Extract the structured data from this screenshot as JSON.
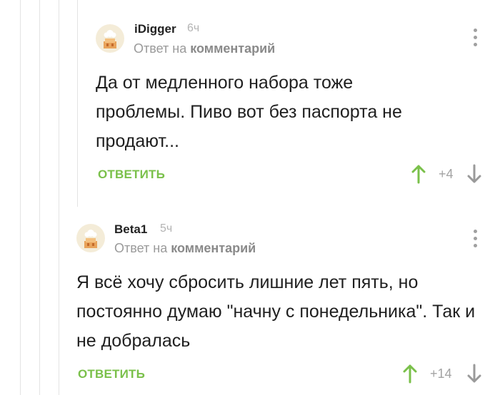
{
  "comments": [
    {
      "author": "iDigger",
      "time": "6ч",
      "reply_prefix": "Ответ на",
      "reply_link": "комментарий",
      "text": "Да от медленного набора тоже проблемы. Пиво вот без паспорта не продают...",
      "reply_button": "ОТВЕТИТЬ",
      "rating": "+4",
      "avatar_icon": "default-avatar-icon",
      "menu_icon": "more-vertical-icon"
    },
    {
      "author": "Beta1",
      "time": "5ч",
      "reply_prefix": "Ответ на",
      "reply_link": "комментарий",
      "text": "Я всё хочу сбросить лишние лет пять, но постоянно думаю \"начну с понедельника\". Так и не добралась",
      "reply_button": "ОТВЕТИТЬ",
      "rating": "+14",
      "avatar_icon": "default-avatar-icon",
      "menu_icon": "more-vertical-icon"
    }
  ],
  "colors": {
    "accent_green": "#7ac04a",
    "up_arrow": "#7ac04a",
    "down_arrow": "#9a9a9a",
    "muted_text": "#9a9a9a"
  }
}
